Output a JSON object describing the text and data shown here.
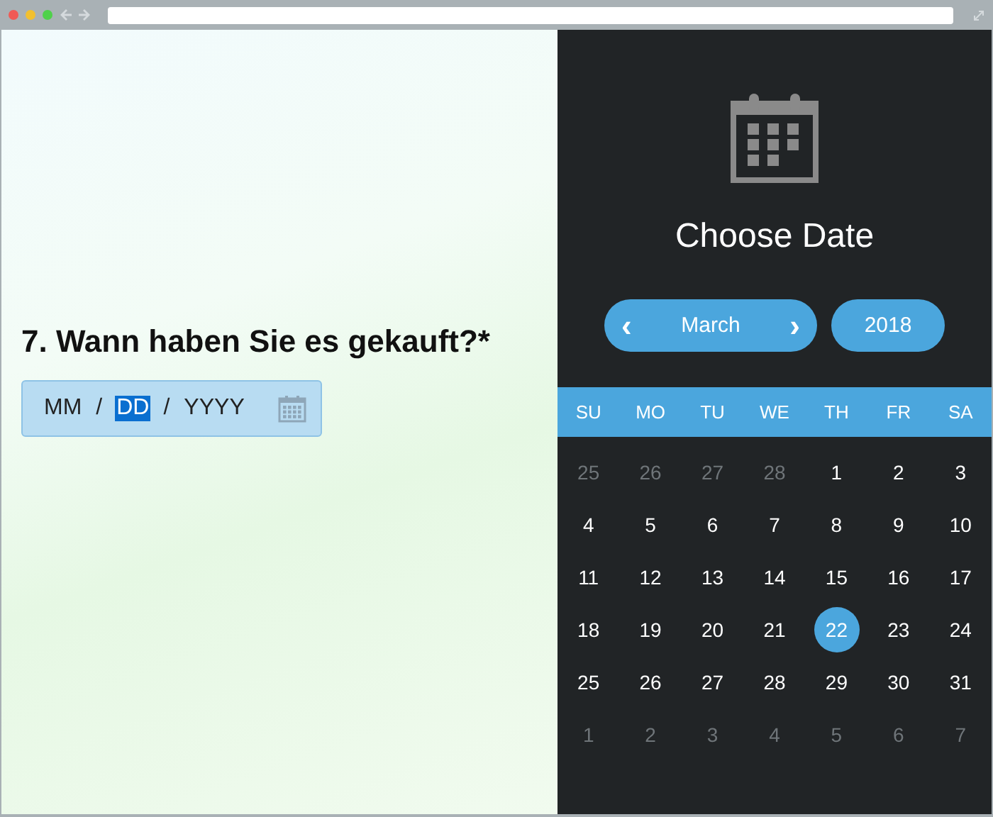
{
  "question": {
    "title": "7. Wann haben Sie es gekauft?*"
  },
  "date_field": {
    "segments": [
      {
        "text": "MM",
        "selected": false
      },
      {
        "text": "DD",
        "selected": true
      },
      {
        "text": "YYYY",
        "selected": false
      }
    ],
    "separator": "/"
  },
  "picker": {
    "title": "Choose Date",
    "month": "March",
    "year": "2018",
    "prev": "‹",
    "next": "›",
    "weekdays": [
      "SU",
      "MO",
      "TU",
      "WE",
      "TH",
      "FR",
      "SA"
    ],
    "days": [
      {
        "text": "25",
        "outside": true,
        "selected": false
      },
      {
        "text": "26",
        "outside": true,
        "selected": false
      },
      {
        "text": "27",
        "outside": true,
        "selected": false
      },
      {
        "text": "28",
        "outside": true,
        "selected": false
      },
      {
        "text": "1",
        "outside": false,
        "selected": false
      },
      {
        "text": "2",
        "outside": false,
        "selected": false
      },
      {
        "text": "3",
        "outside": false,
        "selected": false
      },
      {
        "text": "4",
        "outside": false,
        "selected": false
      },
      {
        "text": "5",
        "outside": false,
        "selected": false
      },
      {
        "text": "6",
        "outside": false,
        "selected": false
      },
      {
        "text": "7",
        "outside": false,
        "selected": false
      },
      {
        "text": "8",
        "outside": false,
        "selected": false
      },
      {
        "text": "9",
        "outside": false,
        "selected": false
      },
      {
        "text": "10",
        "outside": false,
        "selected": false
      },
      {
        "text": "11",
        "outside": false,
        "selected": false
      },
      {
        "text": "12",
        "outside": false,
        "selected": false
      },
      {
        "text": "13",
        "outside": false,
        "selected": false
      },
      {
        "text": "14",
        "outside": false,
        "selected": false
      },
      {
        "text": "15",
        "outside": false,
        "selected": false
      },
      {
        "text": "16",
        "outside": false,
        "selected": false
      },
      {
        "text": "17",
        "outside": false,
        "selected": false
      },
      {
        "text": "18",
        "outside": false,
        "selected": false
      },
      {
        "text": "19",
        "outside": false,
        "selected": false
      },
      {
        "text": "20",
        "outside": false,
        "selected": false
      },
      {
        "text": "21",
        "outside": false,
        "selected": false
      },
      {
        "text": "22",
        "outside": false,
        "selected": true
      },
      {
        "text": "23",
        "outside": false,
        "selected": false
      },
      {
        "text": "24",
        "outside": false,
        "selected": false
      },
      {
        "text": "25",
        "outside": false,
        "selected": false
      },
      {
        "text": "26",
        "outside": false,
        "selected": false
      },
      {
        "text": "27",
        "outside": false,
        "selected": false
      },
      {
        "text": "28",
        "outside": false,
        "selected": false
      },
      {
        "text": "29",
        "outside": false,
        "selected": false
      },
      {
        "text": "30",
        "outside": false,
        "selected": false
      },
      {
        "text": "31",
        "outside": false,
        "selected": false
      },
      {
        "text": "1",
        "outside": true,
        "selected": false
      },
      {
        "text": "2",
        "outside": true,
        "selected": false
      },
      {
        "text": "3",
        "outside": true,
        "selected": false
      },
      {
        "text": "4",
        "outside": true,
        "selected": false
      },
      {
        "text": "5",
        "outside": true,
        "selected": false
      },
      {
        "text": "6",
        "outside": true,
        "selected": false
      },
      {
        "text": "7",
        "outside": true,
        "selected": false
      }
    ]
  }
}
